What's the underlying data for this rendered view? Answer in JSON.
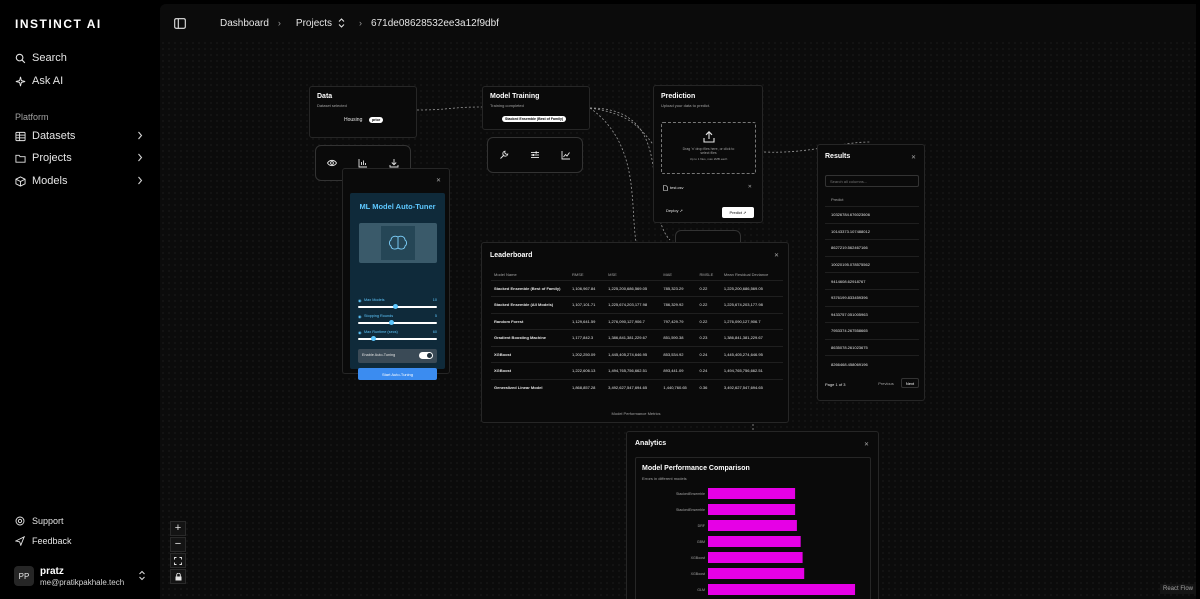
{
  "app": {
    "logo": "INSTINCT AI"
  },
  "sidebar": {
    "top_items": [
      {
        "label": "Search",
        "icon": "search-icon"
      },
      {
        "label": "Ask AI",
        "icon": "sparkle-icon"
      }
    ],
    "section_label": "Platform",
    "platform_items": [
      {
        "label": "Datasets",
        "icon": "table-icon"
      },
      {
        "label": "Projects",
        "icon": "folder-icon"
      },
      {
        "label": "Models",
        "icon": "box-icon"
      }
    ],
    "footer_items": [
      {
        "label": "Support",
        "icon": "lifebuoy-icon"
      },
      {
        "label": "Feedback",
        "icon": "send-icon"
      }
    ],
    "user": {
      "initials": "PP",
      "name": "pratz",
      "email": "me@pratikpakhale.tech"
    }
  },
  "breadcrumb": {
    "dashboard": "Dashboard",
    "projects": "Projects",
    "project_id": "671de08628532ee3a12f9dbf"
  },
  "data_node": {
    "title": "Data",
    "subtitle": "Dataset selected",
    "dataset": "Housing",
    "badge": "price"
  },
  "training_node": {
    "title": "Model Training",
    "subtitle": "Training completed",
    "model": "Stacked Ensemble (Best of Family)"
  },
  "prediction_node": {
    "title": "Prediction",
    "subtitle": "Upload your data to predict.",
    "dropzone_line1": "Drag 'n' drop files here, or click to",
    "dropzone_line2": "select files",
    "dropzone_limit": "Up to 1 files, max 2MB each",
    "file": "test.csv",
    "deploy_label": "Deploy",
    "predict_label": "Predict"
  },
  "tuner_node": {
    "title": "ML Model Auto-Tuner",
    "sliders": [
      {
        "label": "Max Models",
        "value": "10",
        "fraction": 0.62
      },
      {
        "label": "Stopping Rounds",
        "value": "5",
        "fraction": 0.5
      },
      {
        "label": "Max Runtime (secs)",
        "value": "60",
        "fraction": 0.2
      }
    ],
    "toggle_label": "Enable Auto-Tuning",
    "start_label": "Start Auto-Tuning"
  },
  "leaderboard": {
    "title": "Leaderboard",
    "columns": [
      "Model Name",
      "RMSE",
      "MSE",
      "MAE",
      "RMSLE",
      "Mean Residual Deviance"
    ],
    "rows": [
      [
        "Stacked Ensemble (Best of Family)",
        "1,106,967.84",
        "1,225,200,686,569.05",
        "785,323.29",
        "0.22",
        "1,225,200,686,569.05"
      ],
      [
        "Stacked Ensemble (All Models)",
        "1,107,101.71",
        "1,225,674,203,177.98",
        "786,329.92",
        "0.22",
        "1,225,674,203,177.98"
      ],
      [
        "Random Forest",
        "1,129,641.59",
        "1,276,090,127,906.7",
        "797,429.79",
        "0.22",
        "1,276,090,127,906.7"
      ],
      [
        "Gradient Boosting Machine",
        "1,177,842.3",
        "1,386,841,381,229.67",
        "851,590.38",
        "0.23",
        "1,386,841,381,229.67"
      ],
      [
        "XGBoost",
        "1,202,250.09",
        "1,445,405,274,646.95",
        "853,534.92",
        "0.24",
        "1,445,405,274,646.95"
      ],
      [
        "XGBoost",
        "1,222,606.13",
        "1,494,765,756,662.51",
        "893,441.09",
        "0.24",
        "1,494,765,756,662.51"
      ],
      [
        "Generalized Linear Model",
        "1,868,857.28",
        "3,492,627,547,694.65",
        "1,440,760.65",
        "0.36",
        "3,492,627,547,694.65"
      ]
    ],
    "caption": "Model Performance Metrics"
  },
  "results": {
    "title": "Results",
    "search_placeholder": "Search all columns...",
    "column": "Predict",
    "rows": [
      "10326784.676023606",
      "10143373.107488012",
      "8627219.562467166",
      "10020195.078575562",
      "9414608.62918767",
      "9376199.833459396",
      "9433757.051005963",
      "7953374.267558665",
      "8635078.261023675",
      "8266468.458069196"
    ],
    "page_label": "Page 1 of 3",
    "previous_label": "Previous",
    "next_label": "Next"
  },
  "analytics": {
    "title": "Analytics",
    "chart_title": "Model Performance Comparison",
    "chart_subtitle": "Errors in different models"
  },
  "chart_data": {
    "type": "bar",
    "orientation": "horizontal",
    "title": "Model Performance Comparison",
    "subtitle": "Errors in different models",
    "categories": [
      "StackedEnsemble",
      "StackedEnsemble",
      "DRF",
      "GBM",
      "XGBoost",
      "XGBoost",
      "GLM"
    ],
    "values": [
      1106967.84,
      1107101.71,
      1129641.59,
      1177842.3,
      1202250.09,
      1222606.13,
      1868857.28
    ],
    "bar_color": "#e600e6",
    "grid": false
  },
  "flow_footer": {
    "attribution": "React Flow"
  },
  "colors": {
    "accent": "#e600e6",
    "tuner_title": "#5ec8ff",
    "tuner_button": "#3b8cf0"
  }
}
